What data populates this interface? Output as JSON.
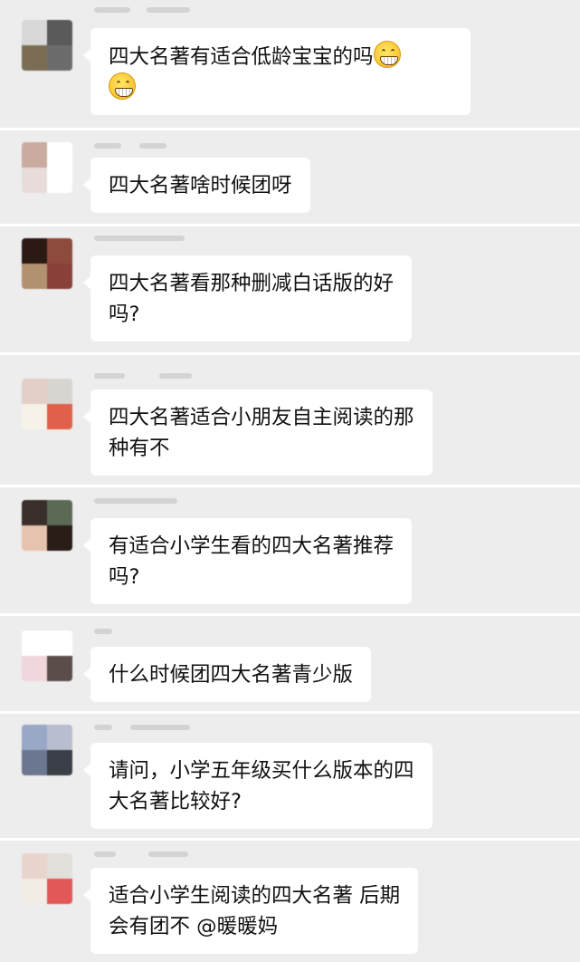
{
  "messages": [
    {
      "text": "四大名著有适合低龄宝宝的吗",
      "emoji": "grinning-face-icon",
      "avatar": [
        "#d8d8d8",
        "#5a5a5a",
        "#7a6d54",
        "#6c6c6c"
      ]
    },
    {
      "text": "四大名著啥时候团呀",
      "avatar": [
        "#c9ab9f",
        "#ffffff",
        "#e8dcdb",
        "#ffffff"
      ]
    },
    {
      "text": "四大名著看那种删减白话版的好\n吗?",
      "avatar": [
        "#2b1a14",
        "#8e4a3c",
        "#b39271",
        "#8a4138"
      ]
    },
    {
      "text": "四大名著适合小朋友自主阅读的那\n种有不",
      "avatar": [
        "#e4cfc8",
        "#d7d5d0",
        "#f6f2e8",
        "#e0604b"
      ]
    },
    {
      "text": "有适合小学生看的四大名著推荐\n吗?",
      "avatar": [
        "#3a2e2a",
        "#5b6a55",
        "#e6c3ad",
        "#2a1c17"
      ]
    },
    {
      "text": "什么时候团四大名著青少版",
      "avatar": [
        "#ffffff",
        "#ffffff",
        "#f1d6db",
        "#5a4d4a"
      ]
    },
    {
      "text": "请问，小学五年级买什么版本的四\n大名著比较好?",
      "avatar": [
        "#99a8c6",
        "#b8bed0",
        "#6c7892",
        "#3a3f48"
      ]
    },
    {
      "text": "适合小学生阅读的四大名著 后期\n会有团不 @暖暖妈",
      "avatar": [
        "#e9d4ce",
        "#e3dfdb",
        "#f1ece4",
        "#e25856"
      ]
    }
  ],
  "colors": {
    "background": "#ededed",
    "bubble": "#ffffff",
    "text": "#111111",
    "separator": "#ffffff"
  }
}
